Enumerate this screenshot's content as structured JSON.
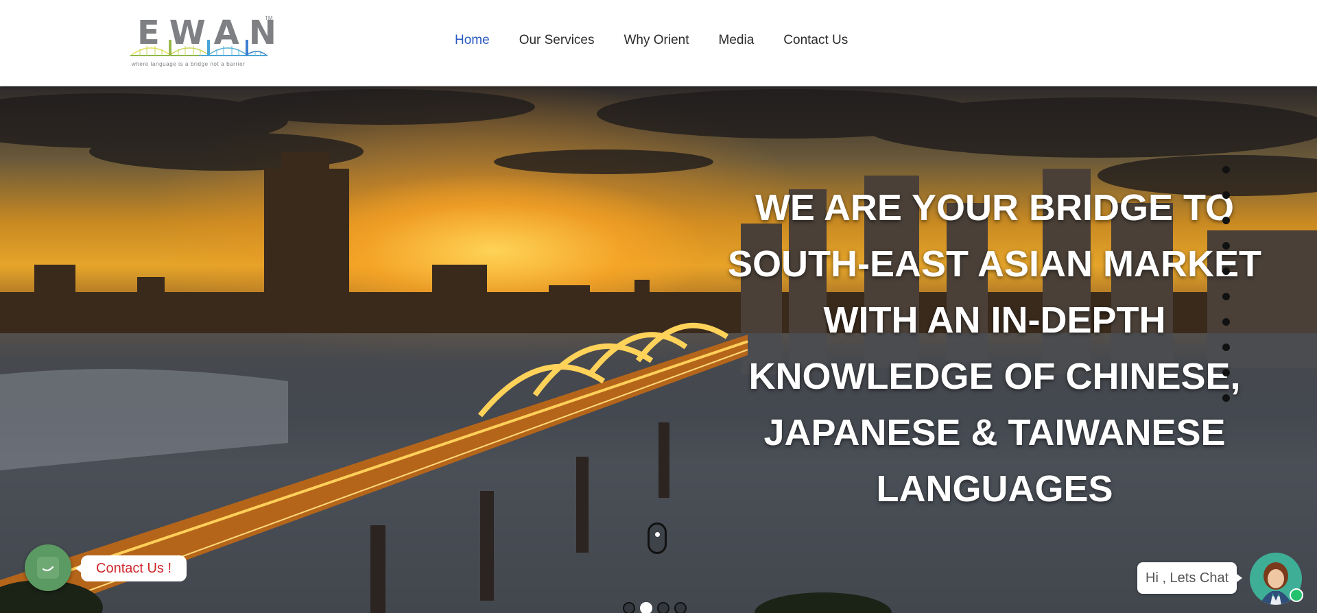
{
  "logo": {
    "wordmark": "EWAN",
    "trademark": "TM",
    "tagline": "where language is a bridge not a barrier"
  },
  "nav": {
    "items": [
      {
        "label": "Home",
        "active": true
      },
      {
        "label": "Our Services",
        "active": false
      },
      {
        "label": "Why Orient",
        "active": false
      },
      {
        "label": "Media",
        "active": false
      },
      {
        "label": "Contact Us",
        "active": false
      }
    ]
  },
  "hero": {
    "headline_lines": [
      "WE ARE YOUR BRIDGE TO",
      "SOUTH-EAST ASIAN MARKET",
      "WITH AN IN-DEPTH",
      "KNOWLEDGE OF CHINESE,",
      "JAPANESE & TAIWANESE",
      "LANGUAGES"
    ],
    "slide_count": 4,
    "active_slide": 2
  },
  "contact_widget": {
    "label": "Contact Us !"
  },
  "chat_widget": {
    "label": "Hi , Lets Chat"
  },
  "colors": {
    "nav_active": "#2a5bbf",
    "contact_text": "#d0262a",
    "contact_button": "#5b9a62",
    "chat_avatar_bg": "#3fae97"
  }
}
